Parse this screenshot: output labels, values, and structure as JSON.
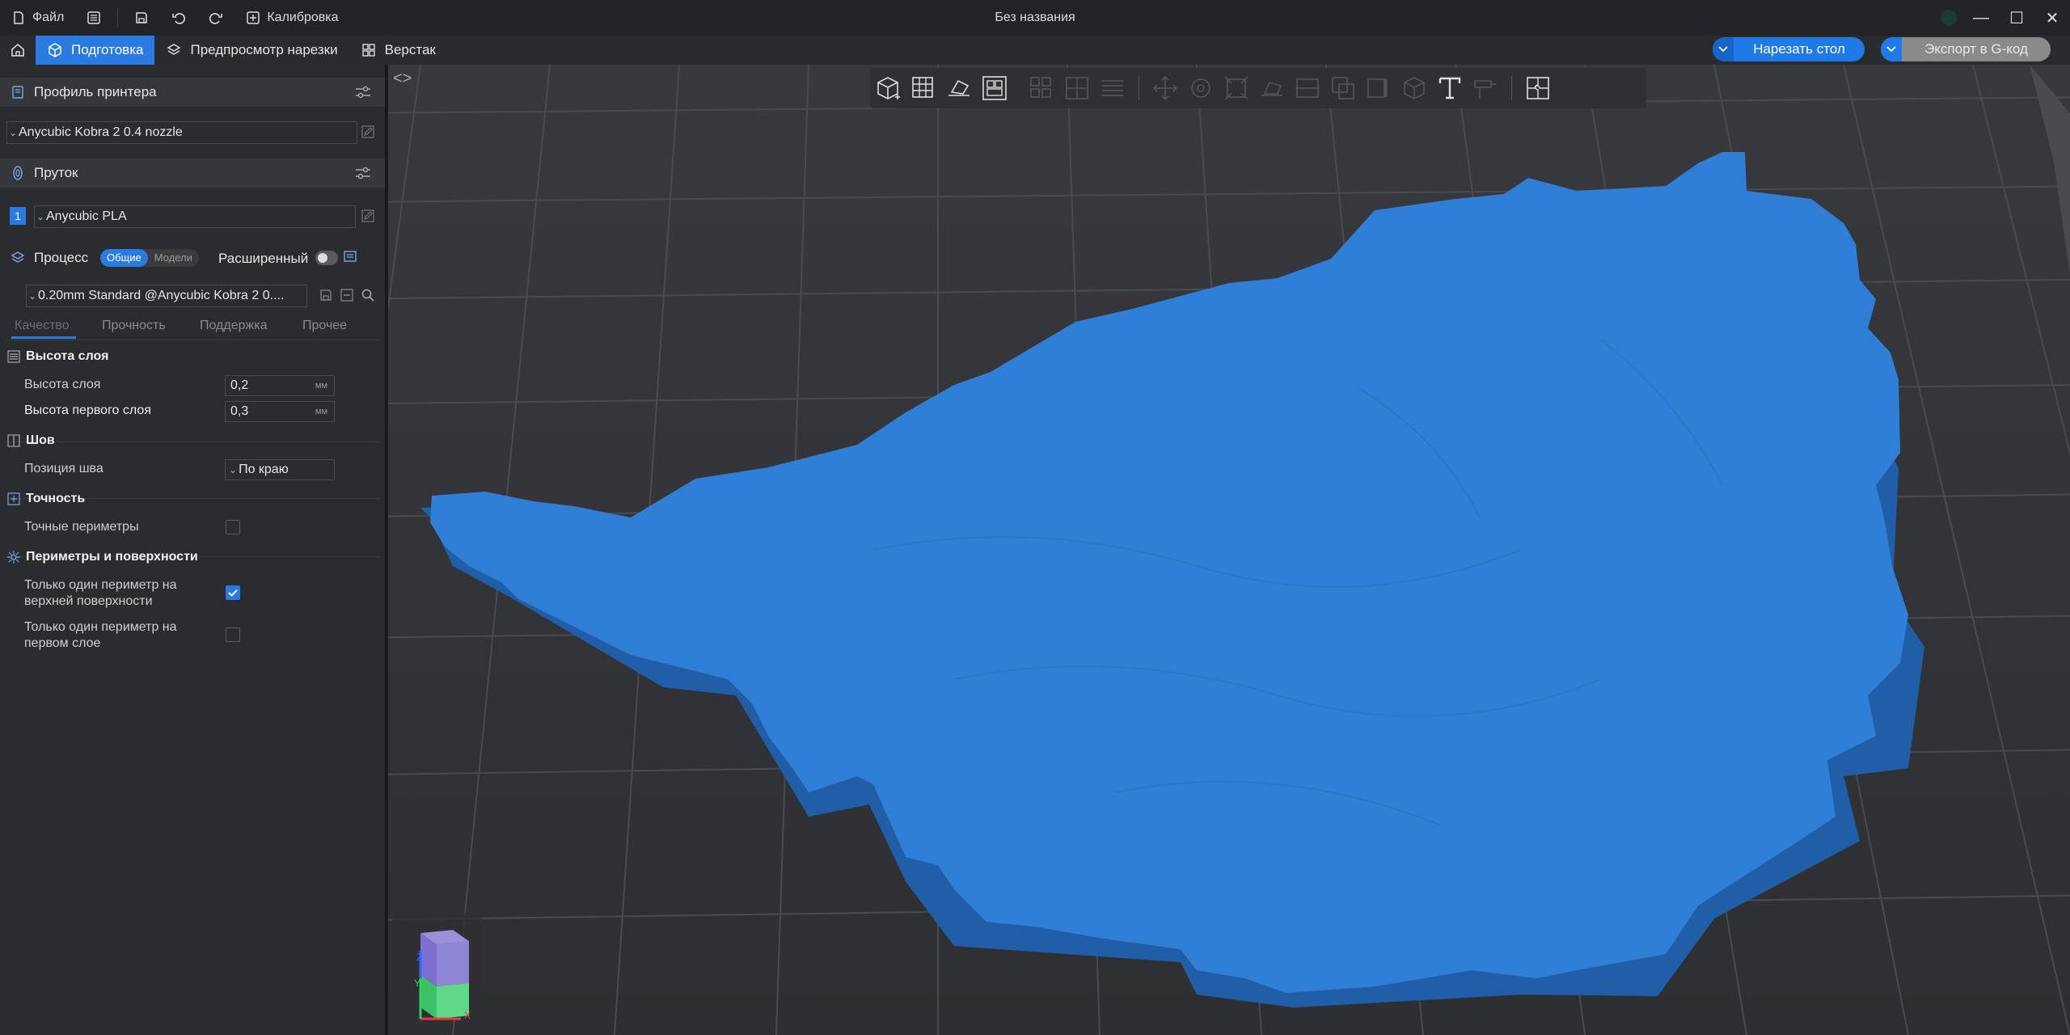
{
  "titlebar": {
    "file_label": "Файл",
    "calibration_label": "Калибровка",
    "window_title": "Без названия"
  },
  "tabs": {
    "prepare": "Подготовка",
    "preview": "Предпросмотр нарезки",
    "workbench": "Верстак"
  },
  "actions": {
    "slice_label": "Нарезать стол",
    "export_label": "Экспорт в G-код"
  },
  "printer": {
    "section_title": "Профиль принтера",
    "selected": "Anycubic Kobra 2 0.4 nozzle"
  },
  "filament": {
    "section_title": "Пруток",
    "slot": "1",
    "selected": "Anycubic PLA"
  },
  "process": {
    "section_title": "Процесс",
    "mode_global": "Общие",
    "mode_objects": "Модели",
    "advanced_label": "Расширенный",
    "advanced_on": false,
    "selected": "0.20mm Standard @Anycubic Kobra 2 0...."
  },
  "subtabs": [
    "Качество",
    "Прочность",
    "Поддержка",
    "Прочее"
  ],
  "settings": {
    "layer_height_group": "Высота слоя",
    "layer_height_label": "Высота слоя",
    "layer_height_value": "0,2",
    "first_layer_label": "Высота первого слоя",
    "first_layer_value": "0,3",
    "unit": "мм",
    "seam_group": "Шов",
    "seam_position_label": "Позиция шва",
    "seam_position_value": "По краю",
    "precision_group": "Точность",
    "precise_wall_label": "Точные периметры",
    "precise_wall_checked": false,
    "walls_group": "Периметры и поверхности",
    "one_wall_top_label_1": "Только один периметр на",
    "one_wall_top_label_2": "верхней поверхности",
    "one_wall_top_checked": true,
    "one_wall_first_label_1": "Только один периметр на",
    "one_wall_first_label_2": "первом слое",
    "one_wall_first_checked": false
  },
  "viewport": {
    "axis_x": "X",
    "axis_y": "Y",
    "axis_z": "Z",
    "model_color": "#2f7fd6",
    "accent": "#2a7ae2"
  }
}
